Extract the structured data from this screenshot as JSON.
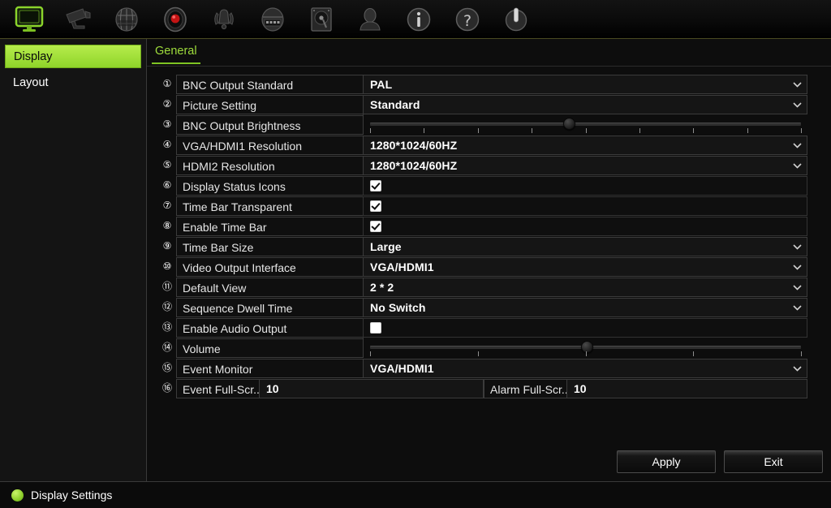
{
  "toolbar": {
    "items": [
      {
        "name": "monitor-icon",
        "label": "Display",
        "active": true
      },
      {
        "name": "camera-icon",
        "label": "Camera",
        "active": false
      },
      {
        "name": "network-icon",
        "label": "Network",
        "active": false
      },
      {
        "name": "record-icon",
        "label": "Record",
        "active": false
      },
      {
        "name": "alarm-icon",
        "label": "Alarm",
        "active": false
      },
      {
        "name": "device-icon",
        "label": "Device",
        "active": false
      },
      {
        "name": "harddisk-icon",
        "label": "HDD",
        "active": false
      },
      {
        "name": "user-icon",
        "label": "User",
        "active": false
      },
      {
        "name": "info-icon",
        "label": "System Info",
        "active": false
      },
      {
        "name": "help-icon",
        "label": "Help",
        "active": false
      },
      {
        "name": "power-icon",
        "label": "Shutdown",
        "active": false
      }
    ]
  },
  "sidebar": {
    "items": [
      {
        "label": "Display",
        "active": true
      },
      {
        "label": "Layout",
        "active": false
      }
    ]
  },
  "tabs": [
    {
      "label": "General",
      "active": true
    }
  ],
  "settings": {
    "rows": [
      {
        "num": "①",
        "label": "BNC Output Standard",
        "type": "select",
        "value": "PAL"
      },
      {
        "num": "②",
        "label": "Picture Setting",
        "type": "select",
        "value": "Standard"
      },
      {
        "num": "③",
        "label": "BNC Output Brightness",
        "type": "slider",
        "value": 46,
        "ticks": 9
      },
      {
        "num": "④",
        "label": "VGA/HDMI1 Resolution",
        "type": "select",
        "value": "1280*1024/60HZ"
      },
      {
        "num": "⑤",
        "label": "HDMI2 Resolution",
        "type": "select",
        "value": "1280*1024/60HZ"
      },
      {
        "num": "⑥",
        "label": "Display Status Icons",
        "type": "checkbox",
        "checked": true
      },
      {
        "num": "⑦",
        "label": "Time Bar Transparent",
        "type": "checkbox",
        "checked": true
      },
      {
        "num": "⑧",
        "label": "Enable Time Bar",
        "type": "checkbox",
        "checked": true
      },
      {
        "num": "⑨",
        "label": "Time Bar Size",
        "type": "select",
        "value": "Large"
      },
      {
        "num": "⑩",
        "label": "Video Output Interface",
        "type": "select",
        "value": "VGA/HDMI1"
      },
      {
        "num": "⑪",
        "label": "Default View",
        "type": "select",
        "value": "2 * 2"
      },
      {
        "num": "⑫",
        "label": "Sequence Dwell Time",
        "type": "select",
        "value": "No Switch"
      },
      {
        "num": "⑬",
        "label": "Enable Audio Output",
        "type": "checkbox",
        "checked": false
      },
      {
        "num": "⑭",
        "label": "Volume",
        "type": "slider",
        "value": 50,
        "ticks": 5
      },
      {
        "num": "⑮",
        "label": "Event Monitor",
        "type": "select",
        "value": "VGA/HDMI1"
      }
    ],
    "row16": {
      "num": "⑯",
      "label_a": "Event Full-Scr...",
      "value_a": "10",
      "label_b": "Alarm Full-Scr...",
      "value_b": "10"
    }
  },
  "buttons": {
    "apply": "Apply",
    "exit": "Exit"
  },
  "statusbar": {
    "text": "Display Settings"
  },
  "colors": {
    "accent_green": "#8fd42a",
    "tab_green": "#9fdd3c",
    "panel_bg": "#0d0d0d",
    "border": "#3b3b3b"
  }
}
